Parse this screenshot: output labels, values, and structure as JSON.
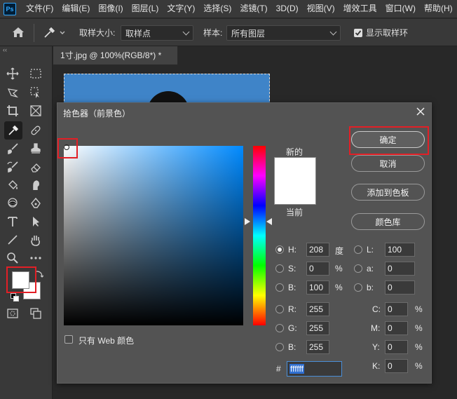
{
  "app": {
    "logo": "Ps"
  },
  "menu": [
    "文件(F)",
    "编辑(E)",
    "图像(I)",
    "图层(L)",
    "文字(Y)",
    "选择(S)",
    "滤镜(T)",
    "3D(D)",
    "视图(V)",
    "增效工具",
    "窗口(W)",
    "帮助(H)"
  ],
  "options_bar": {
    "sample_size_label": "取样大小:",
    "sample_size_value": "取样点",
    "sample_label": "样本:",
    "sample_value": "所有图层",
    "show_ring_label": "显示取样环",
    "show_ring_checked": true
  },
  "document": {
    "tab_title": "1寸.jpg @ 100%(RGB/8*) *"
  },
  "color_picker": {
    "title": "拾色器（前景色）",
    "buttons": {
      "ok": "确定",
      "cancel": "取消",
      "add_to_swatches": "添加到色板",
      "color_libraries": "颜色库"
    },
    "new_label": "新的",
    "current_label": "当前",
    "new_color": "#ffffff",
    "current_color": "#ffffff",
    "hsb": {
      "h_label": "H:",
      "h_value": "208",
      "h_unit": "度",
      "s_label": "S:",
      "s_value": "0",
      "s_unit": "%",
      "b_label": "B:",
      "b_value": "100",
      "b_unit": "%",
      "selected": "H"
    },
    "lab": {
      "l_label": "L:",
      "l_value": "100",
      "a_label": "a:",
      "a_value": "0",
      "b_label": "b:",
      "b_value": "0"
    },
    "rgb": {
      "r_label": "R:",
      "r_value": "255",
      "g_label": "G:",
      "g_value": "255",
      "b_label": "B:",
      "b_value": "255"
    },
    "cmyk": {
      "c_label": "C:",
      "c_value": "0",
      "c_unit": "%",
      "m_label": "M:",
      "m_value": "0",
      "m_unit": "%",
      "y_label": "Y:",
      "y_value": "0",
      "y_unit": "%",
      "k_label": "K:",
      "k_value": "0",
      "k_unit": "%"
    },
    "hex_label": "#",
    "hex_value": "ffffff",
    "web_only_label": "只有 Web 颜色",
    "web_only_checked": false,
    "highlight_color": "#e21f26"
  },
  "icons": [
    "home-icon",
    "eyedropper-icon",
    "move-icon",
    "marquee-icon",
    "lasso-icon",
    "object-select-icon",
    "crop-icon",
    "frame-icon",
    "eyedropper-tool-icon",
    "healing-icon",
    "brush-icon",
    "stamp-icon",
    "history-brush-icon",
    "eraser-icon",
    "bucket-icon",
    "smudge-icon",
    "dodge-icon",
    "pen-icon",
    "type-icon",
    "path-select-icon",
    "line-icon",
    "hand-icon",
    "zoom-icon",
    "more-icon",
    "close-icon"
  ]
}
